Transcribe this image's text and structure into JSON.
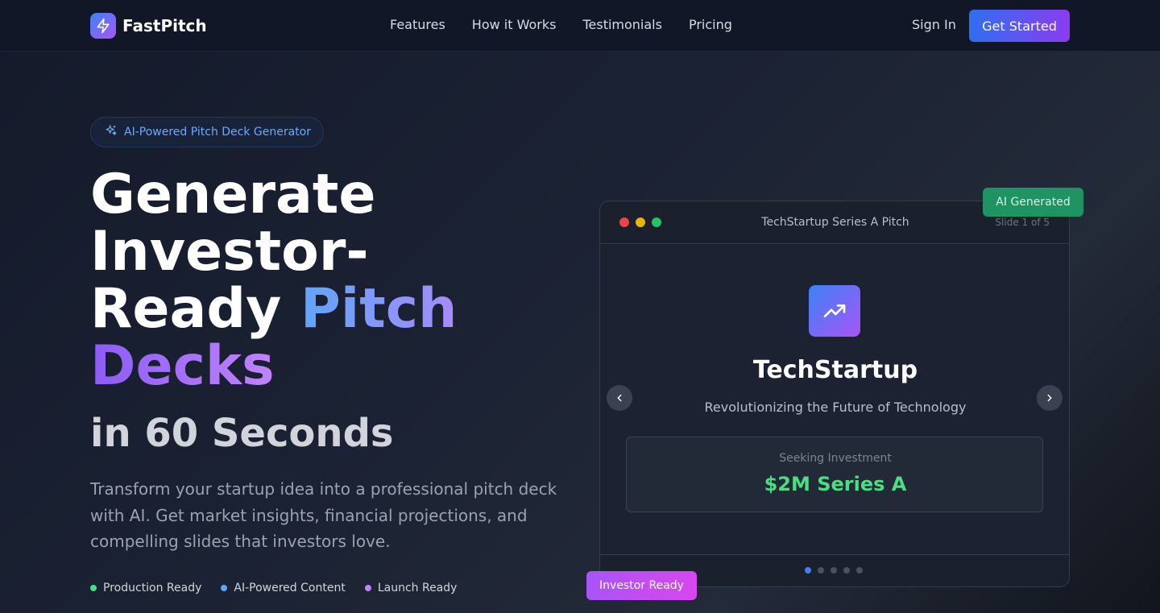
{
  "brand": {
    "name": "FastPitch",
    "icon": "lightning-icon"
  },
  "nav": {
    "links": [
      "Features",
      "How it Works",
      "Testimonials",
      "Pricing"
    ],
    "sign_in": "Sign In",
    "get_started": "Get Started"
  },
  "hero": {
    "badge": "AI-Powered Pitch Deck Generator",
    "headline_1": "Generate",
    "headline_2": "Investor-",
    "headline_3": "Ready ",
    "headline_accent_1": "Pitch",
    "headline_accent_2": "Decks",
    "subheadline": "in 60 Seconds",
    "description": "Transform your startup idea into a professional pitch deck with AI. Get market insights, financial projections, and compelling slides that investors love.",
    "features": [
      {
        "label": "Production Ready",
        "color": "#4ade80"
      },
      {
        "label": "AI-Powered Content",
        "color": "#60a5fa"
      },
      {
        "label": "Launch Ready",
        "color": "#c084fc"
      }
    ]
  },
  "preview": {
    "window_title": "TechStartup Series A Pitch",
    "slide_counter": "Slide 1 of 5",
    "slide_title": "TechStartup",
    "slide_subtitle": "Revolutionizing the Future of Technology",
    "investment_label": "Seeking Investment",
    "investment_value": "$2M Series A",
    "total_slides": 5,
    "current_slide": 1,
    "badge_top": "AI Generated",
    "badge_bottom": "Investor Ready"
  },
  "colors": {
    "accent_blue": "#3b82f6",
    "accent_purple": "#a855f7",
    "success_green": "#4ade80"
  }
}
